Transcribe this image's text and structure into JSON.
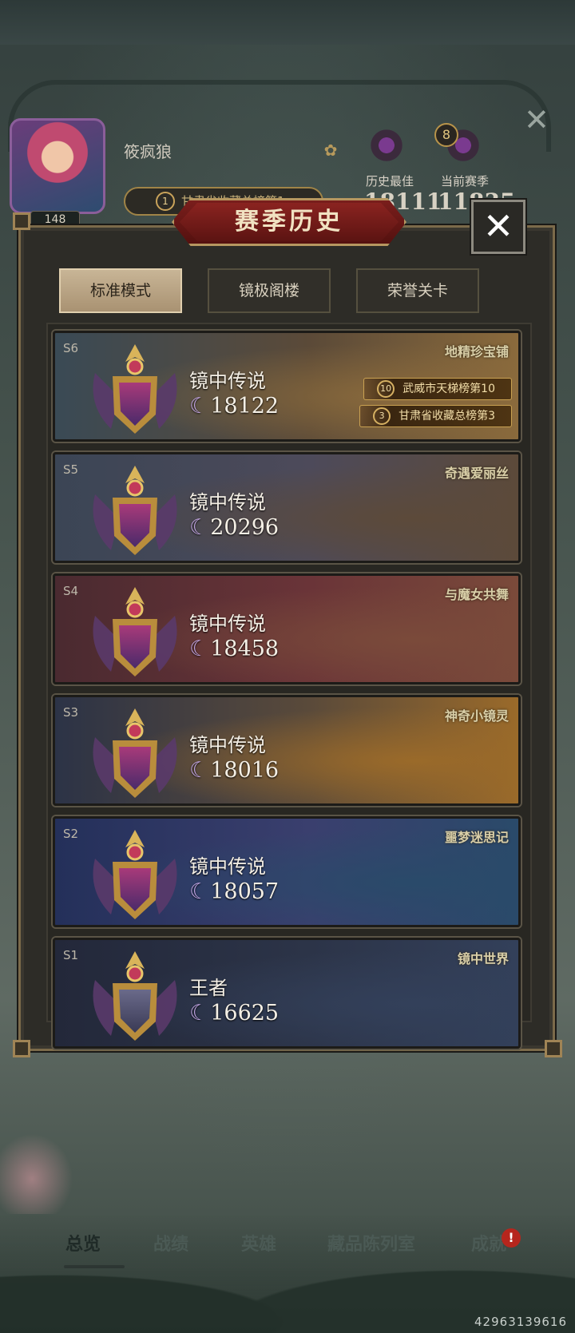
{
  "background_profile": {
    "nickname": "筱疯狼",
    "level": "148",
    "rank_pill_number": "1",
    "rank_pill_text": "甘肃省收藏总榜第1",
    "emblem_badge": "8",
    "stats": [
      {
        "label": "历史最佳",
        "value": "18111"
      },
      {
        "label": "当前赛季",
        "value": "11835"
      }
    ]
  },
  "modal": {
    "title": "赛季历史",
    "close_glyph": "✕",
    "tabs": [
      {
        "label": "标准模式",
        "active": true
      },
      {
        "label": "镜极阁楼",
        "active": false
      },
      {
        "label": "荣誉关卡",
        "active": false
      }
    ],
    "seasons": [
      {
        "season": "S6",
        "rank": "镜中传说",
        "score": "18122",
        "event": "地精珍宝铺",
        "colors": {
          "from": "#3a4a55",
          "mid": "#5b4a38",
          "to": "#8a6a3c"
        },
        "ribbons": [
          {
            "icon": "10",
            "text": "武威市天梯榜第10"
          },
          {
            "icon": "3",
            "text": "甘肃省收藏总榜第3"
          }
        ]
      },
      {
        "season": "S5",
        "rank": "镜中传说",
        "score": "20296",
        "event": "奇遇爱丽丝",
        "colors": {
          "from": "#3b4555",
          "mid": "#4d4a5a",
          "to": "#5c4a3a"
        },
        "ribbons": []
      },
      {
        "season": "S4",
        "rank": "镜中传说",
        "score": "18458",
        "event": "与魔女共舞",
        "colors": {
          "from": "#4a2a30",
          "mid": "#6a3438",
          "to": "#7a4a3a"
        },
        "ribbons": []
      },
      {
        "season": "S3",
        "rank": "镜中传说",
        "score": "18016",
        "event": "神奇小镜灵",
        "colors": {
          "from": "#2c3346",
          "mid": "#5a4a3a",
          "to": "#9a6a2a"
        },
        "ribbons": []
      },
      {
        "season": "S2",
        "rank": "镜中传说",
        "score": "18057",
        "event": "噩梦迷思记",
        "colors": {
          "from": "#24305a",
          "mid": "#3a3f6e",
          "to": "#2a4a6a"
        },
        "ribbons": []
      },
      {
        "season": "S1",
        "rank": "王者",
        "score": "16625",
        "event": "镜中世界",
        "colors": {
          "from": "#23283a",
          "mid": "#2c3448",
          "to": "#33405a"
        },
        "ribbons": []
      }
    ]
  },
  "bottom_nav": {
    "items": [
      "总览",
      "战绩",
      "英雄",
      "藏品陈列室",
      "成就"
    ],
    "notify": "!"
  },
  "uid": "42963139616"
}
